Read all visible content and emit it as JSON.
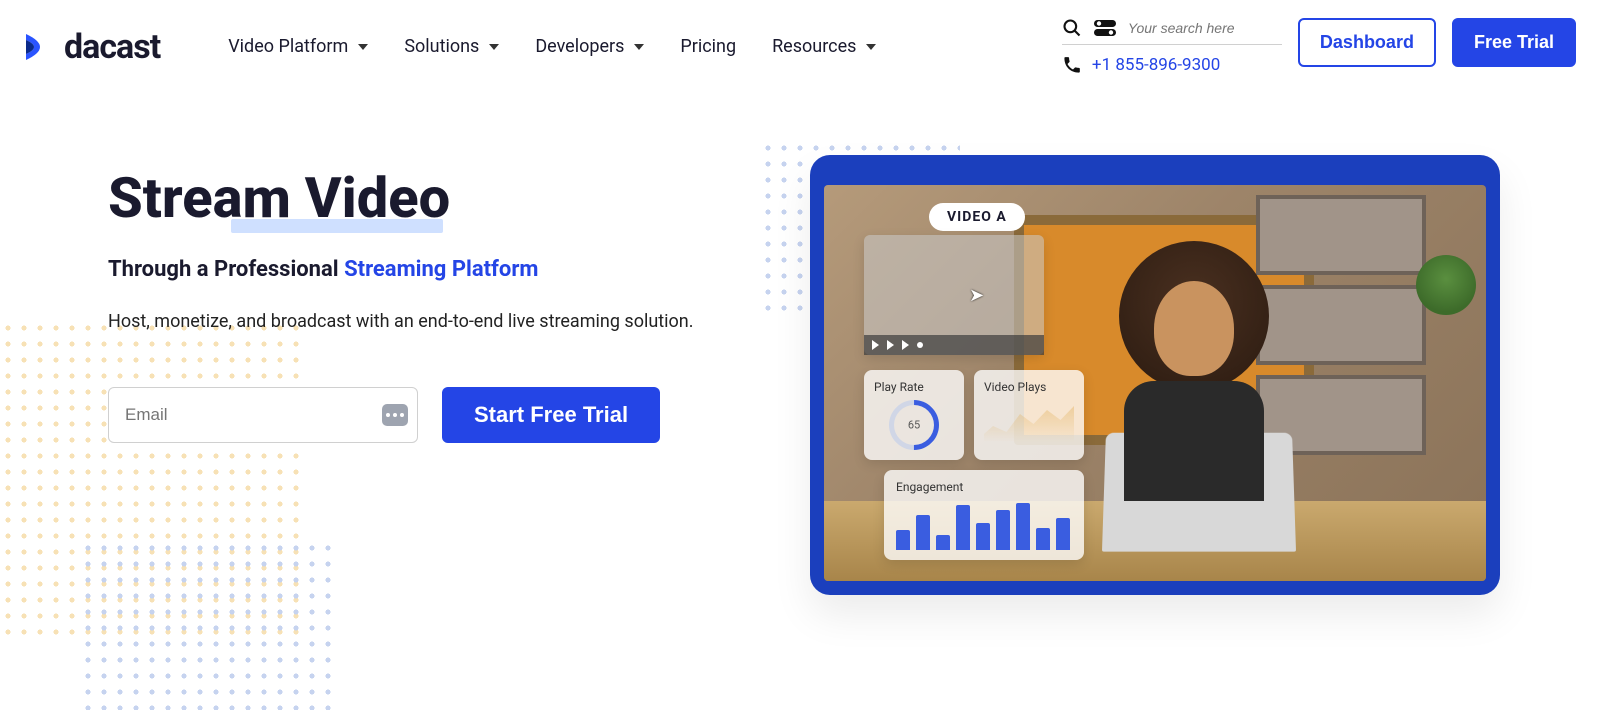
{
  "brand": {
    "name": "dacast"
  },
  "nav": {
    "items": [
      {
        "label": "Video Platform"
      },
      {
        "label": "Solutions"
      },
      {
        "label": "Developers"
      },
      {
        "label": "Pricing"
      },
      {
        "label": "Resources"
      }
    ]
  },
  "search": {
    "placeholder": "Your search here"
  },
  "phone": {
    "number": "+1 855-896-9300"
  },
  "header_buttons": {
    "dashboard": "Dashboard",
    "free_trial": "Free Trial"
  },
  "hero": {
    "title": "Stream Video",
    "subtitle_prefix": "Through a Professional ",
    "subtitle_accent": "Streaming Platform",
    "description": "Host, monetize, and broadcast with an end-to-end live streaming solution.",
    "email_placeholder": "Email",
    "cta": "Start Free Trial"
  },
  "video_overlay": {
    "video_label": "VIDEO A",
    "play_rate_label": "Play Rate",
    "play_rate_value": "65",
    "video_plays_label": "Video Plays",
    "engagement_label": "Engagement"
  }
}
